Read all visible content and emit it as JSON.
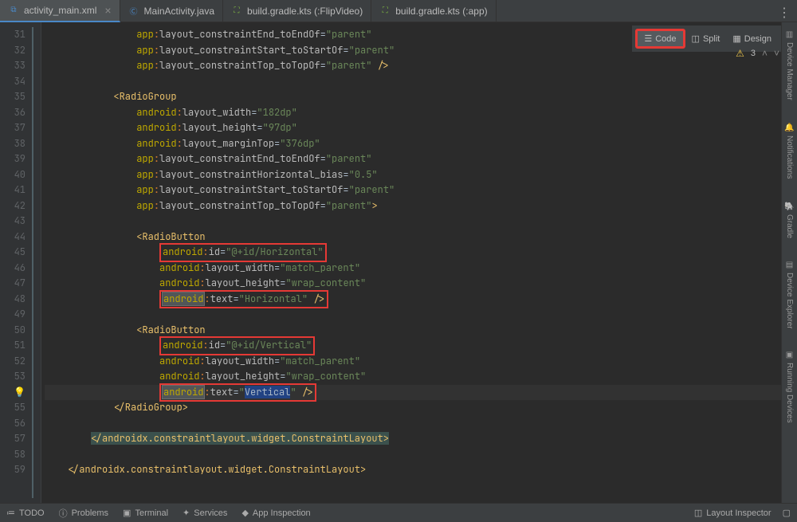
{
  "tabs": [
    {
      "label": "activity_main.xml",
      "icon": "xml"
    },
    {
      "label": "MainActivity.java",
      "icon": "java"
    },
    {
      "label": "build.gradle.kts (:FlipVideo)",
      "icon": "gradle"
    },
    {
      "label": "build.gradle.kts (:app)",
      "icon": "gradle"
    }
  ],
  "viewModes": {
    "code": "Code",
    "split": "Split",
    "design": "Design"
  },
  "warnings": {
    "count": "3"
  },
  "rightRail": [
    "Device Manager",
    "Notifications",
    "Gradle",
    "Device Explorer",
    "Running Devices"
  ],
  "lineStart": 31,
  "code": [
    {
      "indent": 16,
      "t": "attr",
      "ns": "app",
      "name": "layout_constraintEnd_toEndOf",
      "val": "\"parent\""
    },
    {
      "indent": 16,
      "t": "attr",
      "ns": "app",
      "name": "layout_constraintStart_toStartOf",
      "val": "\"parent\""
    },
    {
      "indent": 16,
      "t": "attrclose",
      "ns": "app",
      "name": "layout_constraintTop_toTopOf",
      "val": "\"parent\"",
      "close": " />"
    },
    {
      "indent": 0,
      "t": "blank"
    },
    {
      "indent": 12,
      "t": "open",
      "tag": "RadioGroup"
    },
    {
      "indent": 16,
      "t": "attr",
      "ns": "android",
      "name": "layout_width",
      "val": "\"182dp\""
    },
    {
      "indent": 16,
      "t": "attr",
      "ns": "android",
      "name": "layout_height",
      "val": "\"97dp\""
    },
    {
      "indent": 16,
      "t": "attr",
      "ns": "android",
      "name": "layout_marginTop",
      "val": "\"376dp\""
    },
    {
      "indent": 16,
      "t": "attr",
      "ns": "app",
      "name": "layout_constraintEnd_toEndOf",
      "val": "\"parent\""
    },
    {
      "indent": 16,
      "t": "attr",
      "ns": "app",
      "name": "layout_constraintHorizontal_bias",
      "val": "\"0.5\""
    },
    {
      "indent": 16,
      "t": "attr",
      "ns": "app",
      "name": "layout_constraintStart_toStartOf",
      "val": "\"parent\""
    },
    {
      "indent": 16,
      "t": "attrclose",
      "ns": "app",
      "name": "layout_constraintTop_toTopOf",
      "val": "\"parent\"",
      "close": ">"
    },
    {
      "indent": 0,
      "t": "blank"
    },
    {
      "indent": 16,
      "t": "open",
      "tag": "RadioButton"
    },
    {
      "indent": 20,
      "t": "attr",
      "ns": "android",
      "name": "id",
      "val": "\"@+id/Horizontal\"",
      "ann": "red"
    },
    {
      "indent": 20,
      "t": "attr",
      "ns": "android",
      "name": "layout_width",
      "val": "\"match_parent\""
    },
    {
      "indent": 20,
      "t": "attr",
      "ns": "android",
      "name": "layout_height",
      "val": "\"wrap_content\""
    },
    {
      "indent": 20,
      "t": "attrclose",
      "ns": "android",
      "name": "text",
      "val": "\"Horizontal\"",
      "hl": "android",
      "close": " />",
      "ann": "red"
    },
    {
      "indent": 0,
      "t": "blank"
    },
    {
      "indent": 16,
      "t": "open",
      "tag": "RadioButton"
    },
    {
      "indent": 20,
      "t": "attr",
      "ns": "android",
      "name": "id",
      "val": "\"@+id/Vertical\"",
      "ann": "red"
    },
    {
      "indent": 20,
      "t": "attr",
      "ns": "android",
      "name": "layout_width",
      "val": "\"match_parent\""
    },
    {
      "indent": 20,
      "t": "attr",
      "ns": "android",
      "name": "layout_height",
      "val": "\"wrap_content\""
    },
    {
      "indent": 20,
      "t": "attrclose",
      "ns": "android",
      "name": "text",
      "val": "\"Vertical\"",
      "hl": "android-sel",
      "close": " />",
      "ann": "red",
      "current": true
    },
    {
      "indent": 12,
      "t": "close",
      "tag": "RadioGroup"
    },
    {
      "indent": 0,
      "t": "blank"
    },
    {
      "indent": 8,
      "t": "close",
      "tag": "androidx.constraintlayout.widget.ConstraintLayout",
      "special": true
    },
    {
      "indent": 0,
      "t": "blank"
    },
    {
      "indent": 4,
      "t": "close",
      "tag": "androidx.constraintlayout.widget.ConstraintLayout"
    }
  ],
  "bottom": {
    "left": [
      "TODO",
      "Problems",
      "Terminal",
      "Services",
      "App Inspection"
    ],
    "right": [
      "Layout Inspector"
    ]
  }
}
